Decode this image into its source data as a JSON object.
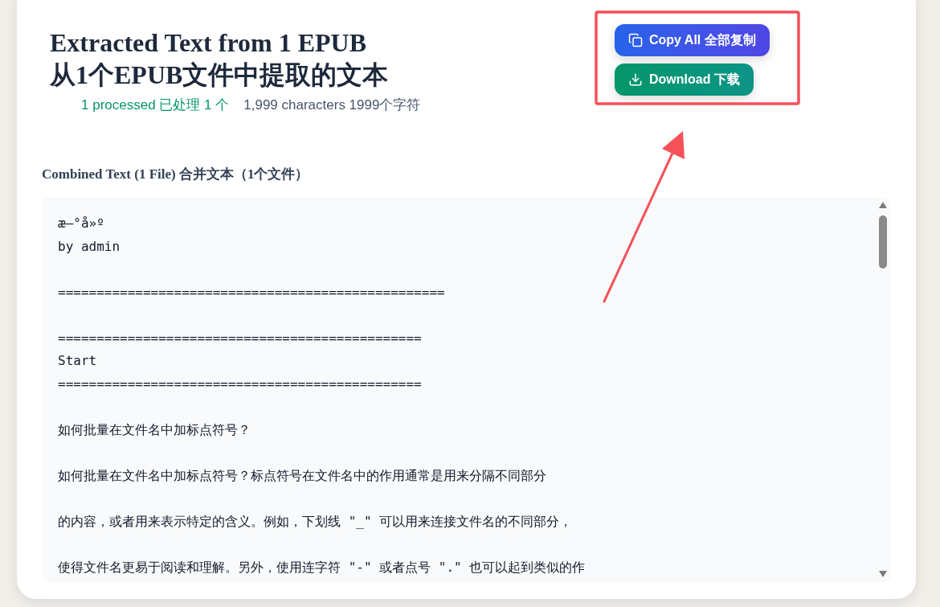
{
  "header": {
    "title_lines": [
      "Extracted Text from 1 EPUB",
      "从1个EPUB文件中提取的文本"
    ],
    "stats": [
      {
        "kind": "success",
        "text": "1 processed 已处理 1 个"
      },
      {
        "kind": "info",
        "text": "1,999 characters 1999个字符"
      }
    ]
  },
  "actions": [
    {
      "kind": "copy",
      "label": "Copy All 全部复制"
    },
    {
      "kind": "download",
      "label": "Download 下载"
    }
  ],
  "combined_text": {
    "label": "Combined Text (1 File) 合并文本（1个文件）",
    "blocks": [
      {
        "lines": [
          "æ–°å»º",
          "by admin"
        ]
      },
      {
        "lines": [
          "=================================================="
        ]
      },
      {
        "lines": [
          "===============================================",
          "Start",
          "==============================================="
        ]
      },
      {
        "lines": [
          "如何批量在文件名中加标点符号？"
        ]
      },
      {
        "lines": [
          "如何批量在文件名中加标点符号？标点符号在文件名中的作用通常是用来分隔不同部分"
        ]
      },
      {
        "lines": [
          "的内容，或者用来表示特定的含义。例如，下划线 \"_\" 可以用来连接文件名的不同部分，"
        ]
      },
      {
        "lines": [
          "使得文件名更易于阅读和理解。另外，使用连字符 \"-\" 或者点号 \".\" 也可以起到类似的作"
        ]
      }
    ]
  }
}
